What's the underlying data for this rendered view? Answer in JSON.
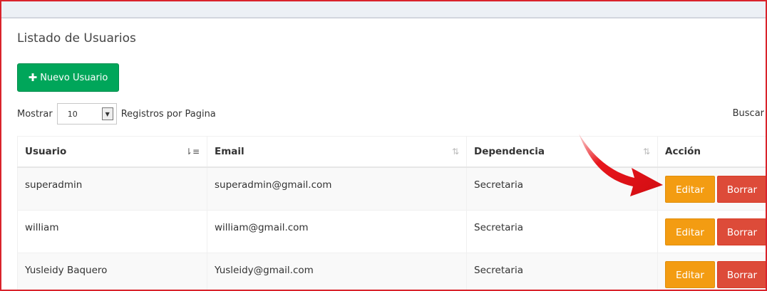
{
  "page": {
    "title": "Listado de Usuarios"
  },
  "toolbar": {
    "new_user_label": "Nuevo Usuario",
    "new_user_icon": "plus-icon"
  },
  "length_control": {
    "prefix": "Mostrar",
    "value": "10",
    "suffix": "Registros por Pagina"
  },
  "search": {
    "label": "Buscar"
  },
  "table": {
    "headers": {
      "user": "Usuario",
      "email": "Email",
      "dependency": "Dependencia",
      "action": "Acción"
    },
    "rows": [
      {
        "user": "superadmin",
        "email": "superadmin@gmail.com",
        "dependency": "Secretaria",
        "edit": "Editar",
        "delete": "Borrar"
      },
      {
        "user": "william",
        "email": "william@gmail.com",
        "dependency": "Secretaria",
        "edit": "Editar",
        "delete": "Borrar"
      },
      {
        "user": "Yusleidy Baquero",
        "email": "Yusleidy@gmail.com",
        "dependency": "Secretaria",
        "edit": "Editar",
        "delete": "Borrar"
      }
    ]
  },
  "colors": {
    "new_button": "#00a65a",
    "edit_button": "#f39c12",
    "delete_button": "#dd4b39",
    "annotation_arrow": "#e8161c",
    "frame_border": "#d9232b"
  }
}
